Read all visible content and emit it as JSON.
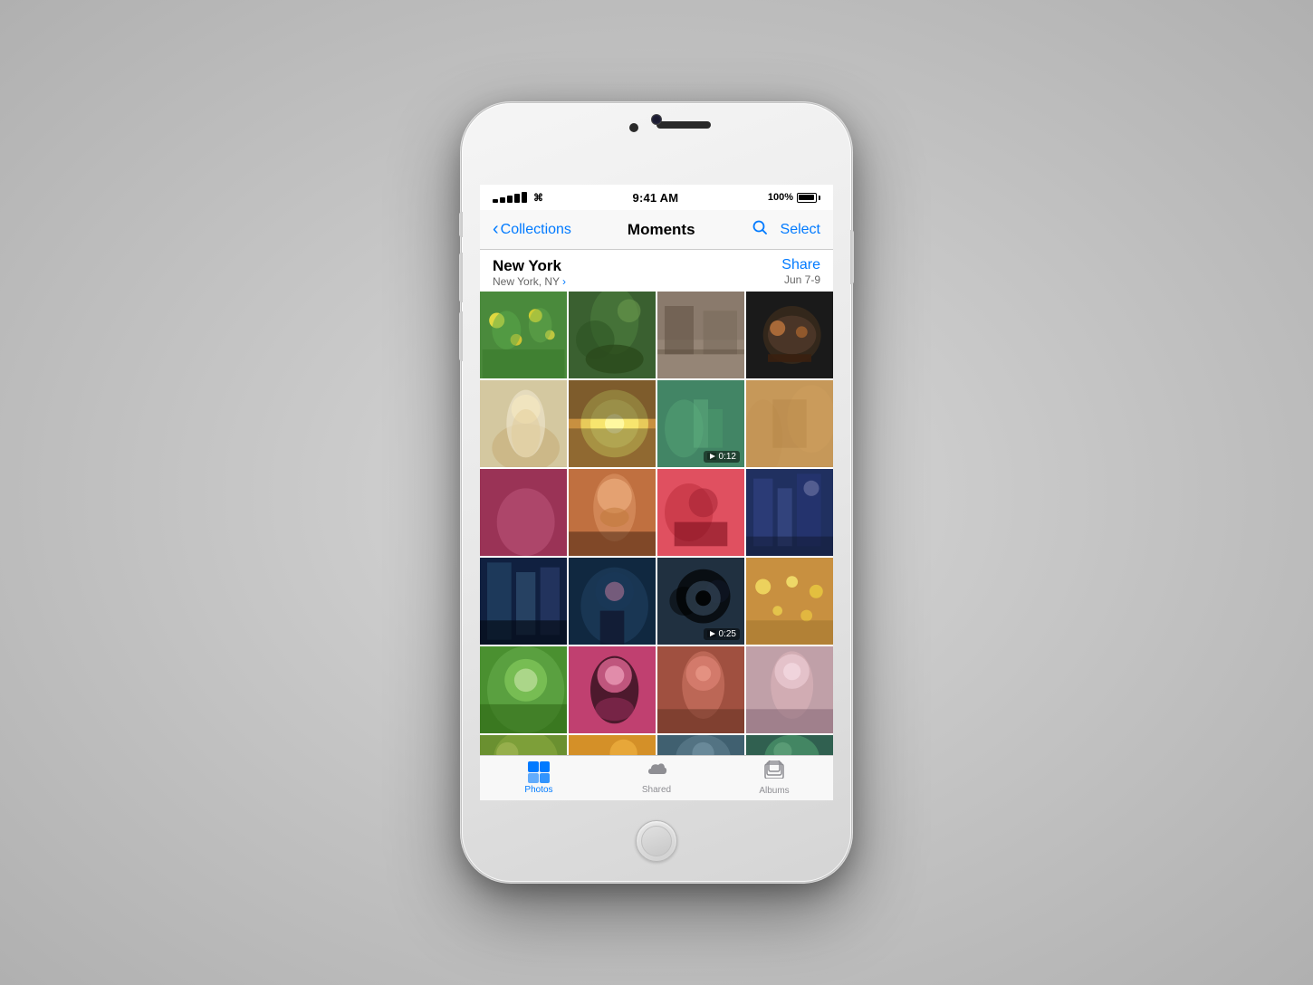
{
  "phone": {
    "status_bar": {
      "signal": "●●●●●",
      "wifi": "wifi",
      "time": "9:41 AM",
      "battery_pct": "100%"
    },
    "nav": {
      "back_label": "Collections",
      "title": "Moments",
      "search_label": "search",
      "select_label": "Select"
    },
    "moment": {
      "city": "New York",
      "location": "New York, NY",
      "share_label": "Share",
      "date_range": "Jun 7-9"
    },
    "photos": [
      {
        "id": 1,
        "color_class": "p1",
        "is_video": false,
        "duration": ""
      },
      {
        "id": 2,
        "color_class": "p2",
        "is_video": false,
        "duration": ""
      },
      {
        "id": 3,
        "color_class": "p3",
        "is_video": false,
        "duration": ""
      },
      {
        "id": 4,
        "color_class": "p4",
        "is_video": false,
        "duration": ""
      },
      {
        "id": 5,
        "color_class": "p5",
        "is_video": false,
        "duration": ""
      },
      {
        "id": 6,
        "color_class": "p6",
        "is_video": false,
        "duration": ""
      },
      {
        "id": 7,
        "color_class": "p7",
        "is_video": true,
        "duration": "0:12"
      },
      {
        "id": 8,
        "color_class": "p8",
        "is_video": false,
        "duration": ""
      },
      {
        "id": 9,
        "color_class": "p9",
        "is_video": false,
        "duration": ""
      },
      {
        "id": 10,
        "color_class": "p10",
        "is_video": false,
        "duration": ""
      },
      {
        "id": 11,
        "color_class": "p11",
        "is_video": false,
        "duration": ""
      },
      {
        "id": 12,
        "color_class": "p12",
        "is_video": false,
        "duration": ""
      },
      {
        "id": 13,
        "color_class": "p13",
        "is_video": false,
        "duration": ""
      },
      {
        "id": 14,
        "color_class": "p14",
        "is_video": false,
        "duration": ""
      },
      {
        "id": 15,
        "color_class": "p15",
        "is_video": true,
        "duration": "0:25"
      },
      {
        "id": 16,
        "color_class": "p16",
        "is_video": false,
        "duration": ""
      },
      {
        "id": 17,
        "color_class": "p17",
        "is_video": false,
        "duration": ""
      },
      {
        "id": 18,
        "color_class": "p18",
        "is_video": false,
        "duration": ""
      },
      {
        "id": 19,
        "color_class": "p19",
        "is_video": false,
        "duration": ""
      },
      {
        "id": 20,
        "color_class": "p20",
        "is_video": false,
        "duration": ""
      },
      {
        "id": 21,
        "color_class": "p21",
        "is_video": false,
        "duration": ""
      },
      {
        "id": 22,
        "color_class": "p22",
        "is_video": false,
        "duration": ""
      },
      {
        "id": 23,
        "color_class": "p23",
        "is_video": false,
        "duration": ""
      },
      {
        "id": 24,
        "color_class": "p24",
        "is_video": false,
        "duration": ""
      }
    ],
    "tabs": [
      {
        "id": "photos",
        "label": "Photos",
        "active": true
      },
      {
        "id": "shared",
        "label": "Shared",
        "active": false
      },
      {
        "id": "albums",
        "label": "Albums",
        "active": false
      }
    ]
  }
}
